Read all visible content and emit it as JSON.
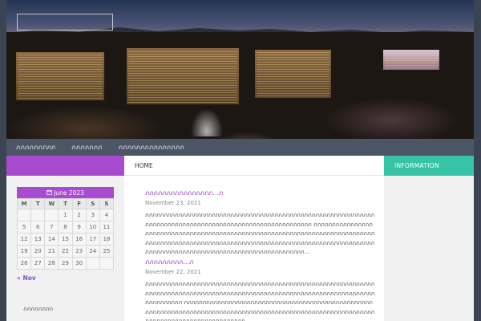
{
  "header": {
    "logo_box": ""
  },
  "nav": {
    "items": [
      {
        "label": "ภภภภภภภภภ"
      },
      {
        "label": "ภภภภภภภ"
      },
      {
        "label": "ภภภภภภภภภภภภภภภ"
      }
    ]
  },
  "calendar": {
    "caption_icon": "calendar-icon",
    "caption": "June 2023",
    "weekdays": [
      "M",
      "T",
      "W",
      "T",
      "F",
      "S",
      "S"
    ],
    "weeks": [
      [
        "",
        "",
        "",
        "1",
        "2",
        "3",
        "4"
      ],
      [
        "5",
        "6",
        "7",
        "8",
        "9",
        "10",
        "11"
      ],
      [
        "12",
        "13",
        "14",
        "15",
        "16",
        "17",
        "18"
      ],
      [
        "19",
        "20",
        "21",
        "22",
        "23",
        "24",
        "25"
      ],
      [
        "26",
        "27",
        "28",
        "29",
        "30",
        "",
        ""
      ]
    ],
    "prev_link": "« Nov"
  },
  "left_widget": {
    "text": "ภภภภภภภภ"
  },
  "main": {
    "tab": "HOME",
    "posts": [
      {
        "title": "ภภภภภภภภภภภภภภภภ...ภ",
        "date": "November 23, 2021",
        "excerpt": "ภภภภภภภภภภภภภภภภภภภภภภภภภภภภภภภภภภภภภภภภภภภภภภภภภภภภภภภภภภภภภภภภภภภภภภภภภภภภภภภภภภภภภภภภภภภภภภภภภภภภภภภภภภภ ภภภภภภภภภภภภภภภภภภภภภภภภภภภภภภภภภภภภภภภภภภภภภภภภภภภภภภภภภภภภภภภภภภภภภภภภภภภภภภภภภภภภภภภภภภภภภภภภภภภภภภภภภภภภภภภภภภภภภภภภภภภภภภภภภภภภภภภภภภภภภภภภภภภภภภภภภภภภภภภภภภภภภภภภภภภภภภภภภภภภภภภ..."
      },
      {
        "title": "ภภภภภภภภภ...ภ",
        "date": "November 22, 2021",
        "excerpt": "ภภภภภภภภภภภภภภภภภภภภภภภภภภภภภภภภภภภภภภภภภภภภภภภภภภภภภภภภภภภภภภภภภภภภภภภภภภภภภภภภภภภภภภภภภภภภภภภภภภภภภภภภภภภภภภภภภภภภภภภภภภภภภภภภภภภภภภ ภภภภภภภภภภภภภภภภภภภภภภภภภภภภภภภภภภภภภภภภภภภภภภภภภภภภภภภภภภภภภภภภภภภภภภภภภภภภภภภภภภภภภภภภภภภภภภภภภภภภภภภภภภภภภภภภภภภภภภภภภภภภภภภภภภภภภภภภภภภภ..."
      }
    ]
  },
  "right_widget": {
    "title": "INFORMATION"
  },
  "colors": {
    "purple": "#a84bd0",
    "teal": "#37c4a6",
    "nav": "#4b5566",
    "link": "#9b3fc7"
  }
}
